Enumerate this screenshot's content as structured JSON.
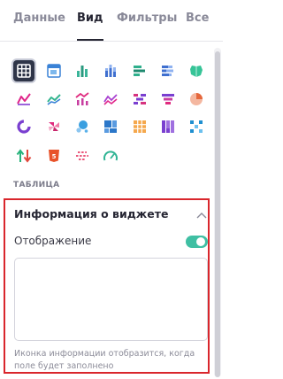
{
  "tabs": [
    {
      "label": "Данные",
      "active": false
    },
    {
      "label": "Вид",
      "active": true
    },
    {
      "label": "Фильтры",
      "active": false
    },
    {
      "label": "Все",
      "active": false
    }
  ],
  "chart_types": [
    "table-icon",
    "pivot-table-icon",
    "column-chart-icon",
    "stacked-column-chart-icon",
    "bar-chart-icon",
    "stacked-bar-chart-icon",
    "map-icon",
    "line-chart-icon",
    "area-chart-icon",
    "line-column-chart-icon",
    "multi-line-chart-icon",
    "stacked-area-chart-icon",
    "funnel-chart-icon",
    "pie-chart-icon",
    "donut-chart-icon",
    "heatmap-chart-icon",
    "bubble-chart-icon",
    "treemap-icon",
    "grid-table-icon",
    "marimekko-icon",
    "sankey-icon",
    "indicator-arrows-icon",
    "html-widget-icon",
    "timeline-icon",
    "gauge-icon"
  ],
  "selected_chart": "table-icon",
  "section_label": "ТАБЛИЦА",
  "widget_info": {
    "title": "Информация о виджете",
    "display_label": "Отображение",
    "display_enabled": true,
    "text_value": "",
    "hint": "Иконка информации отобразится, когда поле будет заполнено"
  },
  "colors": {
    "accent_teal": "#3fbfa3",
    "highlight_red": "#d9262c",
    "selected_bg": "#2f3548"
  }
}
